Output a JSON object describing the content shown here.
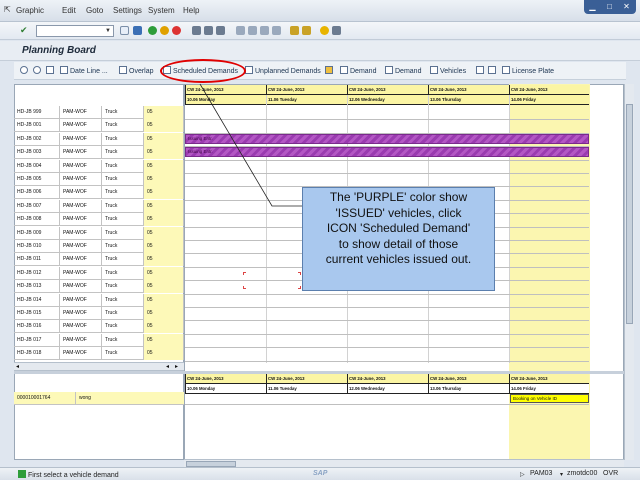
{
  "menu": [
    "Graphic",
    "Edit",
    "Goto",
    "Settings",
    "System",
    "Help"
  ],
  "page_title": "Planning Board",
  "app_toolbar": [
    "Date Line ...",
    "Overlap",
    "Scheduled Demands",
    "Unplanned Demands",
    "Demand",
    "Demand",
    "Vehicles",
    "License Plate"
  ],
  "vehicles": [
    {
      "id": "HD-JB 999",
      "org": "PAM-WOF",
      "type": "Truck",
      "num": "05"
    },
    {
      "id": "HD-JB 001",
      "org": "PAM-WOF",
      "type": "Truck",
      "num": "05"
    },
    {
      "id": "HD-JB 002",
      "org": "PAM-WOF",
      "type": "Truck",
      "num": "05"
    },
    {
      "id": "HD-JB 003",
      "org": "PAM-WOF",
      "type": "Truck",
      "num": "05"
    },
    {
      "id": "HD-JB 004",
      "org": "PAM-WOF",
      "type": "Truck",
      "num": "05"
    },
    {
      "id": "HD-JB 005",
      "org": "PAM-WOF",
      "type": "Truck",
      "num": "05"
    },
    {
      "id": "HD-JB 006",
      "org": "PAM-WOF",
      "type": "Truck",
      "num": "05"
    },
    {
      "id": "HD-JB 007",
      "org": "PAM-WOF",
      "type": "Truck",
      "num": "05"
    },
    {
      "id": "HD-JB 008",
      "org": "PAM-WOF",
      "type": "Truck",
      "num": "05"
    },
    {
      "id": "HD-JB 009",
      "org": "PAM-WOF",
      "type": "Truck",
      "num": "05"
    },
    {
      "id": "HD-JB 010",
      "org": "PAM-WOF",
      "type": "Truck",
      "num": "05"
    },
    {
      "id": "HD-JB 011",
      "org": "PAM-WOF",
      "type": "Truck",
      "num": "05"
    },
    {
      "id": "HD-JB 012",
      "org": "PAM-WOF",
      "type": "Truck",
      "num": "05"
    },
    {
      "id": "HD-JB 013",
      "org": "PAM-WOF",
      "type": "Truck",
      "num": "05"
    },
    {
      "id": "HD-JB 014",
      "org": "PAM-WOF",
      "type": "Truck",
      "num": "05"
    },
    {
      "id": "HD-JB 015",
      "org": "PAM-WOF",
      "type": "Truck",
      "num": "05"
    },
    {
      "id": "HD-JB 016",
      "org": "PAM-WOF",
      "type": "Truck",
      "num": "05"
    },
    {
      "id": "HD-JB 017",
      "org": "PAM-WOF",
      "type": "Truck",
      "num": "05"
    },
    {
      "id": "HD-JB 018",
      "org": "PAM-WOF",
      "type": "Truck",
      "num": "05"
    }
  ],
  "weeks": [
    "CW 24-June, 2013",
    "CW 24-June, 2013",
    "CW 24-June, 2013",
    "CW 24-June, 2013",
    "CW 24-June, 2013"
  ],
  "days": [
    "10.06 Monday",
    "11.06 Tuesday",
    "12.06 Wednesday",
    "13.06 Thursday",
    "14.06 Friday"
  ],
  "issued_bars": [
    {
      "row": 2,
      "label": "Issuing Entr."
    },
    {
      "row": 3,
      "label": "Issuing Entr."
    }
  ],
  "demand_row": {
    "id": "000010001764",
    "name": "wong"
  },
  "demand_booking": "Booking on Vehicle ID",
  "callout_lines": [
    "The 'PURPLE' color show",
    "'ISSUED' vehicles, click",
    "ICON 'Scheduled Demand'",
    "to show detail of those",
    "current vehicles issued out."
  ],
  "status": {
    "message": "First select a vehicle demand",
    "logo": "SAP",
    "session": "PAM03",
    "server": "zmotdc00",
    "mode": "OVR"
  },
  "colors": {
    "issued": "#9a3bb0",
    "highlight_oval": "#e00000",
    "callout_bg": "#a9c8ee",
    "today_column": "#fbf6b0"
  }
}
